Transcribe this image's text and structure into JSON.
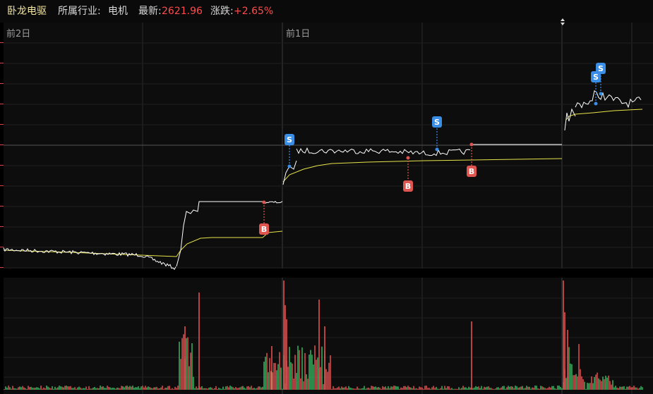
{
  "header": {
    "stock_name": "卧龙电驱",
    "industry_label": "所属行业:",
    "industry": "电机",
    "latest_label": "最新:",
    "latest": "2621.96",
    "change_label": "涨跌:",
    "change": "+2.65%"
  },
  "days": [
    "前2日",
    "前1日"
  ],
  "colors": {
    "price": "#ffffff",
    "avg": "#e8e34a",
    "buy": "#e0554f",
    "sell": "#3a8ee6",
    "vol_up": "#ff5a5a",
    "vol_down": "#3ccf6c",
    "grid": "#2a2a2a"
  },
  "markers": {
    "buy": "B",
    "sell": "S"
  },
  "icons": {
    "expand": "expand-arrows-icon"
  }
}
